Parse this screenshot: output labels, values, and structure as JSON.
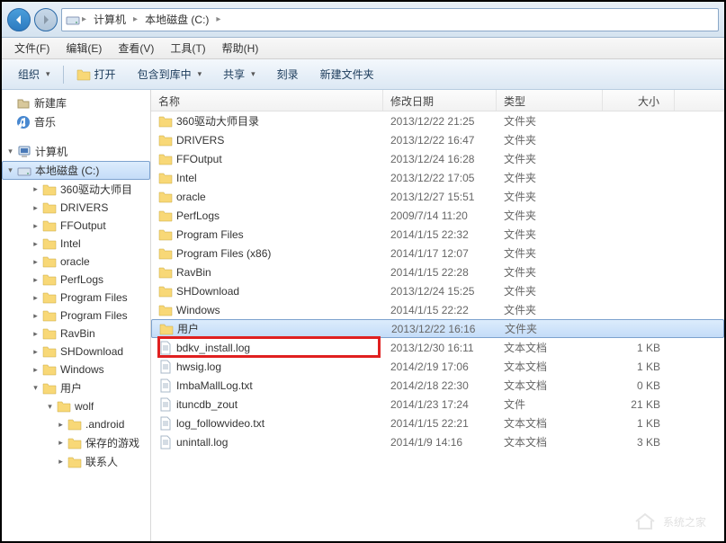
{
  "breadcrumb": {
    "items": [
      "计算机",
      "本地磁盘 (C:)"
    ]
  },
  "menu": {
    "file": "文件(F)",
    "edit": "编辑(E)",
    "view": "查看(V)",
    "tools": "工具(T)",
    "help": "帮助(H)"
  },
  "toolbar": {
    "organize": "组织",
    "open": "打开",
    "include": "包含到库中",
    "share": "共享",
    "burn": "刻录",
    "newfolder": "新建文件夹"
  },
  "columns": {
    "name": "名称",
    "date": "修改日期",
    "type": "类型",
    "size": "大小"
  },
  "tree": {
    "newlib": "新建库",
    "music": "音乐",
    "computer": "计算机",
    "drive_c": "本地磁盘 (C:)",
    "items": [
      "360驱动大师目",
      "DRIVERS",
      "FFOutput",
      "Intel",
      "oracle",
      "PerfLogs",
      "Program Files",
      "Program Files",
      "RavBin",
      "SHDownload",
      "Windows",
      "用户"
    ],
    "user_sub": [
      "wolf",
      ".android",
      "保存的游戏",
      "联系人"
    ]
  },
  "files": [
    {
      "name": "360驱动大师目录",
      "date": "2013/12/22 21:25",
      "type": "文件夹",
      "size": "",
      "icon": "folder"
    },
    {
      "name": "DRIVERS",
      "date": "2013/12/22 16:47",
      "type": "文件夹",
      "size": "",
      "icon": "folder"
    },
    {
      "name": "FFOutput",
      "date": "2013/12/24 16:28",
      "type": "文件夹",
      "size": "",
      "icon": "folder"
    },
    {
      "name": "Intel",
      "date": "2013/12/22 17:05",
      "type": "文件夹",
      "size": "",
      "icon": "folder"
    },
    {
      "name": "oracle",
      "date": "2013/12/27 15:51",
      "type": "文件夹",
      "size": "",
      "icon": "folder"
    },
    {
      "name": "PerfLogs",
      "date": "2009/7/14 11:20",
      "type": "文件夹",
      "size": "",
      "icon": "folder"
    },
    {
      "name": "Program Files",
      "date": "2014/1/15 22:32",
      "type": "文件夹",
      "size": "",
      "icon": "folder"
    },
    {
      "name": "Program Files (x86)",
      "date": "2014/1/17 12:07",
      "type": "文件夹",
      "size": "",
      "icon": "folder"
    },
    {
      "name": "RavBin",
      "date": "2014/1/15 22:28",
      "type": "文件夹",
      "size": "",
      "icon": "folder"
    },
    {
      "name": "SHDownload",
      "date": "2013/12/24 15:25",
      "type": "文件夹",
      "size": "",
      "icon": "folder"
    },
    {
      "name": "Windows",
      "date": "2014/1/15 22:22",
      "type": "文件夹",
      "size": "",
      "icon": "folder"
    },
    {
      "name": "用户",
      "date": "2013/12/22 16:16",
      "type": "文件夹",
      "size": "",
      "icon": "folder",
      "selected": true
    },
    {
      "name": "bdkv_install.log",
      "date": "2013/12/30 16:11",
      "type": "文本文档",
      "size": "1 KB",
      "icon": "file"
    },
    {
      "name": "hwsig.log",
      "date": "2014/2/19 17:06",
      "type": "文本文档",
      "size": "1 KB",
      "icon": "file"
    },
    {
      "name": "ImbaMallLog.txt",
      "date": "2014/2/18 22:30",
      "type": "文本文档",
      "size": "0 KB",
      "icon": "file"
    },
    {
      "name": "ituncdb_zout",
      "date": "2014/1/23 17:24",
      "type": "文件",
      "size": "21 KB",
      "icon": "file"
    },
    {
      "name": "log_followvideo.txt",
      "date": "2014/1/15 22:21",
      "type": "文本文档",
      "size": "1 KB",
      "icon": "file"
    },
    {
      "name": "unintall.log",
      "date": "2014/1/9 14:16",
      "type": "文本文档",
      "size": "3 KB",
      "icon": "file"
    }
  ],
  "watermark": "系统之家"
}
